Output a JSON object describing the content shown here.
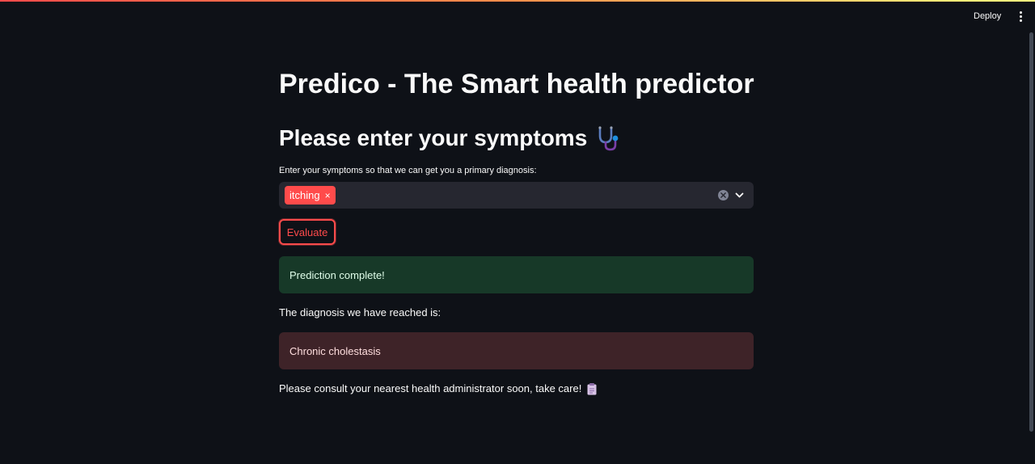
{
  "header": {
    "deploy_label": "Deploy",
    "menu_icon": "kebab-menu-icon"
  },
  "main": {
    "title": "Predico - The Smart health predictor",
    "subtitle": "Please enter your symptoms",
    "subtitle_icon": "stethoscope-icon",
    "symptom_input": {
      "label": "Enter your symptoms so that we can get you a primary diagnosis:",
      "selected": [
        "itching"
      ],
      "tag_remove_glyph": "×"
    },
    "evaluate_label": "Evaluate",
    "success_message": "Prediction complete!",
    "diagnosis_label": "The diagnosis we have reached is:",
    "diagnosis": "Chronic cholestasis",
    "consult_message": "Please consult your nearest health administrator soon, take care!",
    "consult_icon": "clipboard-icon"
  },
  "colors": {
    "background": "#0e1117",
    "accent": "#ff4b4b",
    "input_bg": "#262730",
    "success_bg": "#173928",
    "error_bg": "#3e2328"
  }
}
